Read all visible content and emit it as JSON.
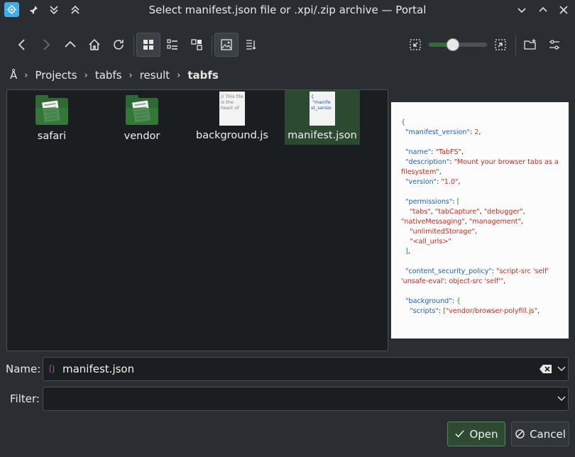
{
  "window": {
    "title": "Select manifest.json file or .xpi/.zip archive — Portal"
  },
  "breadcrumb": {
    "root_icon": "root-glyph",
    "root_label": "Å",
    "items": [
      "Projects",
      "tabfs",
      "result"
    ],
    "current": "tabfs"
  },
  "toolbar": {
    "zoom_level": 0.42
  },
  "files": [
    {
      "name": "safari",
      "kind": "folder"
    },
    {
      "name": "vendor",
      "kind": "folder"
    },
    {
      "name": "background.js",
      "kind": "text",
      "thumb": "// This file is the heart of"
    },
    {
      "name": "manifest.json",
      "kind": "json",
      "thumb": "{\n \"manife\nst_versio",
      "selected": true
    }
  ],
  "preview": {
    "lines": [
      "{",
      "  \"manifest_version\": 2,",
      "",
      "  \"name\": \"TabFS\",",
      "  \"description\": \"Mount your browser tabs as a filesystem\",",
      "  \"version\": \"1.0\",",
      "",
      "  \"permissions\": [",
      "    \"tabs\", \"tabCapture\", \"debugger\", \"nativeMessaging\", \"management\",",
      "    \"unlimitedStorage\",",
      "    \"<all_urls>\"",
      "  ],",
      "",
      "  \"content_security_policy\": \"script-src 'self' 'unsafe-eval'; object-src 'self'\",",
      "",
      "  \"background\": {",
      "    \"scripts\": [\"vendor/browser-polyfill.js\","
    ]
  },
  "form": {
    "name_label": "Name:",
    "name_value": "manifest.json",
    "filter_label": "Filter:",
    "filter_value": ""
  },
  "buttons": {
    "open": "Open",
    "cancel": "Cancel"
  },
  "colors": {
    "accent": "#2e6b34",
    "selection": "#2c4a30",
    "background": "#2a2e32"
  }
}
